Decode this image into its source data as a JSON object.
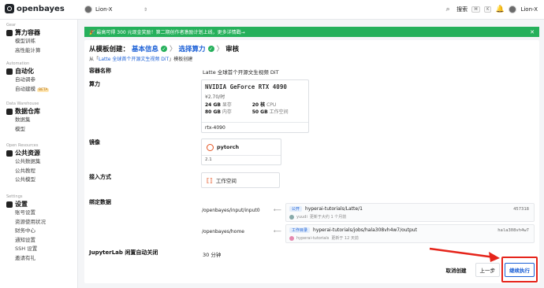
{
  "topbar": {
    "logo": "openbayes",
    "user": "Lion-X",
    "search_label": "搜索",
    "kbd1": "⌘",
    "kbd2": "K",
    "account": "Lion-X"
  },
  "sidebar": {
    "sections": [
      {
        "small": "Gear",
        "title": "算力容器",
        "items": [
          "模型训练",
          "高性能计算"
        ]
      },
      {
        "small": "Automation",
        "title": "自动化",
        "items": [
          "自动调参",
          "自动建模"
        ]
      },
      {
        "small": "Data Warehouse",
        "title": "数据仓库",
        "items": [
          "数据集",
          "模型"
        ]
      },
      {
        "small": "Open Resources",
        "title": "公共资源",
        "items": [
          "公共数据集",
          "公共教程",
          "公共模型"
        ]
      },
      {
        "small": "Settings",
        "title": "设置",
        "items": [
          "账号设置",
          "资源使用状况",
          "财务中心",
          "通知设置",
          "SSH 设置",
          "邀请有礼"
        ]
      }
    ],
    "beta": "BETA"
  },
  "banner": {
    "text": "🎉 最高可得 300 元现金奖励！第二期创作者激励计划上线，更多详情戳→",
    "close": "✕"
  },
  "steps": {
    "prefix": "从模板创建：",
    "step1": "基本信息",
    "step2": "选择算力",
    "step3": "审核",
    "subtitle_pre": "从「",
    "subtitle_link": "Latte 全球首个开源文生视频 DiT",
    "subtitle_post": "」模板创建"
  },
  "form": {
    "name_label": "容器名称",
    "name_value": "Latte 全球首个开源文生视频 DiT",
    "compute_label": "算力",
    "gpu": {
      "name": "NVIDIA GeForce RTX 4090",
      "price": "¥2.70/时",
      "vram": "24 GB",
      "vram_unit": "显存",
      "cpu": "20 核",
      "cpu_unit": "CPU",
      "mem": "80 GB",
      "mem_unit": "内存",
      "disk": "50 GB",
      "disk_unit": "工作空间",
      "tag": "rtx-4090"
    },
    "image_label": "镜像",
    "image_name": "pytorch",
    "image_version": "2.1",
    "access_label": "接入方式",
    "access_value": "工作空间",
    "bind_label": "绑定数据",
    "mount1": {
      "path": "/openbayes/input/input0",
      "badge": "公开",
      "repo": "hyperai-tutorials/Latte/1",
      "user": "yuudi",
      "time": "更新于大约 1 个月前",
      "hash": "457318"
    },
    "mount2": {
      "path": "/openbayes/home",
      "badge": "工作目录",
      "repo": "hyperai-tutorials/jobs/hala308vh4w7/output",
      "user": "hyperai-tutorials",
      "time": "更新于 12 天前",
      "hash": "hala308vh4w7"
    },
    "idle_label": "JupyterLab 闲置自动关闭",
    "idle_value": "30 分钟"
  },
  "buttons": {
    "cancel": "取消创建",
    "prev": "上一步",
    "next": "继续执行"
  }
}
